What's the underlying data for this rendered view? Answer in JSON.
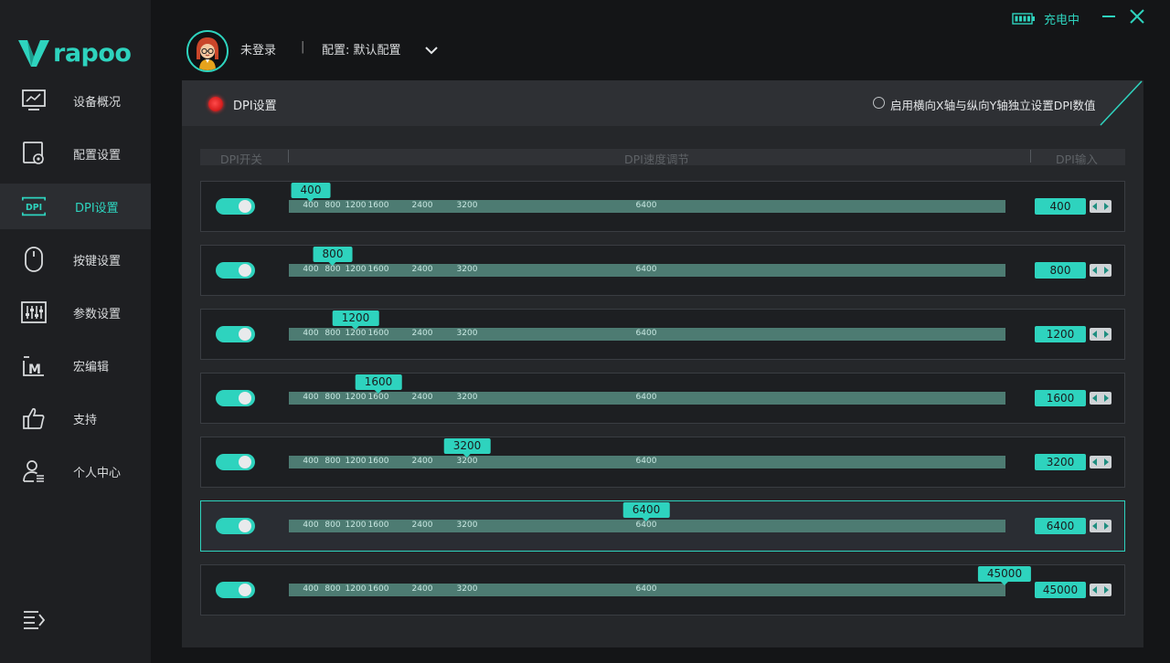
{
  "app": {
    "brand": "rapoo"
  },
  "sidebar": {
    "items": [
      {
        "label": "设备概况",
        "icon": "monitor-chart-icon",
        "active": false
      },
      {
        "label": "配置设置",
        "icon": "config-gear-icon",
        "active": false
      },
      {
        "label": "DPI设置",
        "icon": "dpi-icon",
        "active": true
      },
      {
        "label": "按键设置",
        "icon": "mouse-icon",
        "active": false
      },
      {
        "label": "参数设置",
        "icon": "sliders-icon",
        "active": false
      },
      {
        "label": "宏编辑",
        "icon": "macro-m-icon",
        "active": false
      },
      {
        "label": "支持",
        "icon": "thumbs-up-icon",
        "active": false
      },
      {
        "label": "个人中心",
        "icon": "user-icon",
        "active": false
      }
    ]
  },
  "topbar": {
    "login_status": "未登录",
    "divider": "|",
    "config_label": "配置: 默认配置",
    "charging_text": "充电中"
  },
  "panel": {
    "title": "DPI设置",
    "xy_option_label": "启用横向X轴与纵向Y轴独立设置DPI数值",
    "columns": {
      "switch": "DPI开关",
      "speed": "DPI速度调节",
      "input": "DPI输入"
    },
    "tick_labels": [
      "400",
      "800",
      "1200",
      "1600",
      "2400",
      "3200",
      "6400"
    ],
    "rows": [
      {
        "enabled": true,
        "value": "400",
        "selected": false
      },
      {
        "enabled": true,
        "value": "800",
        "selected": false
      },
      {
        "enabled": true,
        "value": "1200",
        "selected": false
      },
      {
        "enabled": true,
        "value": "1600",
        "selected": false
      },
      {
        "enabled": true,
        "value": "3200",
        "selected": false
      },
      {
        "enabled": true,
        "value": "6400",
        "selected": true
      },
      {
        "enabled": true,
        "value": "45000",
        "selected": false
      }
    ]
  },
  "colors": {
    "accent": "#2ed3be",
    "track": "#4d7b72",
    "indicator_red": "#e02424"
  }
}
